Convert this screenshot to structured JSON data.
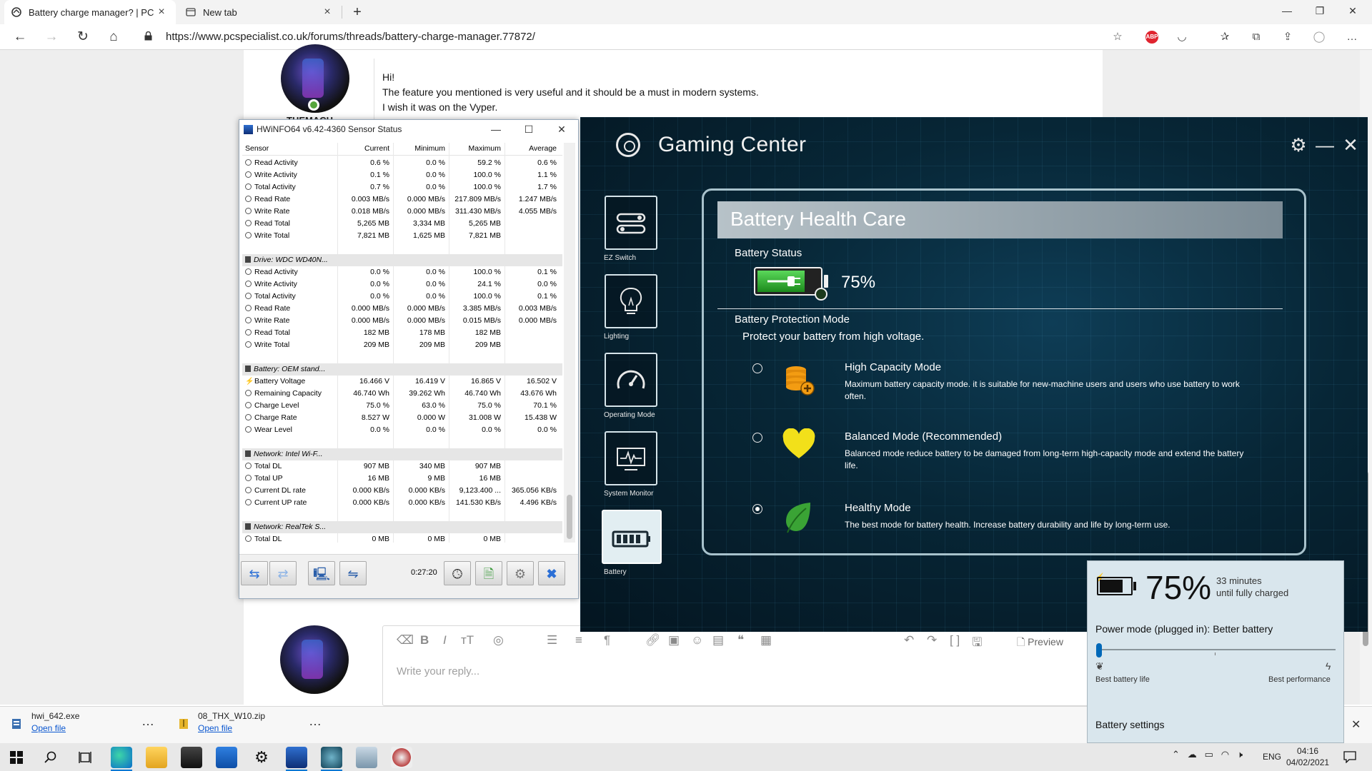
{
  "browser": {
    "tabs": [
      {
        "title": "Battery charge manager? | PCSPE"
      },
      {
        "title": "New tab"
      }
    ],
    "new_tab_symbol": "+",
    "url": "https://www.pcspecialist.co.uk/forums/threads/battery-charge-manager.77872/",
    "extension_abp": "ABP"
  },
  "post": {
    "username_partial": "THEMACH",
    "lines": [
      "Hi!",
      "The feature you mentioned is very useful and it should be a must in modern systems.",
      "I wish it was on the Vyper."
    ],
    "reply_placeholder": "Write your reply...",
    "preview_label": "Preview"
  },
  "hwinfo": {
    "title": "HWiNFO64 v6.42-4360 Sensor Status",
    "columns": [
      "Sensor",
      "Current",
      "Minimum",
      "Maximum",
      "Average"
    ],
    "rows": [
      {
        "type": "sensor",
        "icon": "circle",
        "cells": [
          "Read Activity",
          "0.6 %",
          "0.0 %",
          "59.2 %",
          "0.6 %"
        ]
      },
      {
        "type": "sensor",
        "icon": "circle",
        "cells": [
          "Write Activity",
          "0.1 %",
          "0.0 %",
          "100.0 %",
          "1.1 %"
        ]
      },
      {
        "type": "sensor",
        "icon": "circle",
        "cells": [
          "Total Activity",
          "0.7 %",
          "0.0 %",
          "100.0 %",
          "1.7 %"
        ]
      },
      {
        "type": "sensor",
        "icon": "circle",
        "cells": [
          "Read Rate",
          "0.003 MB/s",
          "0.000 MB/s",
          "217.809 MB/s",
          "1.247 MB/s"
        ]
      },
      {
        "type": "sensor",
        "icon": "circle",
        "cells": [
          "Write Rate",
          "0.018 MB/s",
          "0.000 MB/s",
          "311.430 MB/s",
          "4.055 MB/s"
        ]
      },
      {
        "type": "sensor",
        "icon": "circle",
        "cells": [
          "Read Total",
          "5,265 MB",
          "3,334 MB",
          "5,265 MB",
          ""
        ]
      },
      {
        "type": "sensor",
        "icon": "circle",
        "cells": [
          "Write Total",
          "7,821 MB",
          "1,625 MB",
          "7,821 MB",
          ""
        ]
      },
      {
        "type": "blank",
        "cells": [
          "",
          "",
          "",
          "",
          ""
        ]
      },
      {
        "type": "group",
        "icon": "drive",
        "cells": [
          "Drive: WDC WD40N...",
          "",
          "",
          "",
          ""
        ]
      },
      {
        "type": "sensor",
        "icon": "circle",
        "cells": [
          "Read Activity",
          "0.0 %",
          "0.0 %",
          "100.0 %",
          "0.1 %"
        ]
      },
      {
        "type": "sensor",
        "icon": "circle",
        "cells": [
          "Write Activity",
          "0.0 %",
          "0.0 %",
          "24.1 %",
          "0.0 %"
        ]
      },
      {
        "type": "sensor",
        "icon": "circle",
        "cells": [
          "Total Activity",
          "0.0 %",
          "0.0 %",
          "100.0 %",
          "0.1 %"
        ]
      },
      {
        "type": "sensor",
        "icon": "circle",
        "cells": [
          "Read Rate",
          "0.000 MB/s",
          "0.000 MB/s",
          "3.385 MB/s",
          "0.003 MB/s"
        ]
      },
      {
        "type": "sensor",
        "icon": "circle",
        "cells": [
          "Write Rate",
          "0.000 MB/s",
          "0.000 MB/s",
          "0.015 MB/s",
          "0.000 MB/s"
        ]
      },
      {
        "type": "sensor",
        "icon": "circle",
        "cells": [
          "Read Total",
          "182 MB",
          "178 MB",
          "182 MB",
          ""
        ]
      },
      {
        "type": "sensor",
        "icon": "circle",
        "cells": [
          "Write Total",
          "209 MB",
          "209 MB",
          "209 MB",
          ""
        ]
      },
      {
        "type": "blank",
        "cells": [
          "",
          "",
          "",
          "",
          ""
        ]
      },
      {
        "type": "group",
        "icon": "drive",
        "cells": [
          "Battery: OEM stand...",
          "",
          "",
          "",
          ""
        ]
      },
      {
        "type": "sensor",
        "icon": "bolt",
        "cells": [
          "Battery Voltage",
          "16.466 V",
          "16.419 V",
          "16.865 V",
          "16.502 V"
        ]
      },
      {
        "type": "sensor",
        "icon": "circle",
        "cells": [
          "Remaining Capacity",
          "46.740 Wh",
          "39.262 Wh",
          "46.740 Wh",
          "43.676 Wh"
        ]
      },
      {
        "type": "sensor",
        "icon": "circle",
        "cells": [
          "Charge Level",
          "75.0 %",
          "63.0 %",
          "75.0 %",
          "70.1 %"
        ]
      },
      {
        "type": "sensor",
        "icon": "circle",
        "cells": [
          "Charge Rate",
          "8.527 W",
          "0.000 W",
          "31.008 W",
          "15.438 W"
        ]
      },
      {
        "type": "sensor",
        "icon": "circle",
        "cells": [
          "Wear Level",
          "0.0 %",
          "0.0 %",
          "0.0 %",
          "0.0 %"
        ]
      },
      {
        "type": "blank",
        "cells": [
          "",
          "",
          "",
          "",
          ""
        ]
      },
      {
        "type": "group",
        "icon": "drive",
        "cells": [
          "Network: Intel Wi-F...",
          "",
          "",
          "",
          ""
        ]
      },
      {
        "type": "sensor",
        "icon": "circle",
        "cells": [
          "Total DL",
          "907 MB",
          "340 MB",
          "907 MB",
          ""
        ]
      },
      {
        "type": "sensor",
        "icon": "circle",
        "cells": [
          "Total UP",
          "16 MB",
          "9 MB",
          "16 MB",
          ""
        ]
      },
      {
        "type": "sensor",
        "icon": "circle",
        "cells": [
          "Current DL rate",
          "0.000 KB/s",
          "0.000 KB/s",
          "9,123.400 ...",
          "365.056 KB/s"
        ]
      },
      {
        "type": "sensor",
        "icon": "circle",
        "cells": [
          "Current UP rate",
          "0.000 KB/s",
          "0.000 KB/s",
          "141.530 KB/s",
          "4.496 KB/s"
        ]
      },
      {
        "type": "blank",
        "cells": [
          "",
          "",
          "",
          "",
          ""
        ]
      },
      {
        "type": "group",
        "icon": "drive",
        "cells": [
          "Network: RealTek S...",
          "",
          "",
          "",
          ""
        ]
      },
      {
        "type": "sensor",
        "icon": "circle",
        "cells": [
          "Total DL",
          "0 MB",
          "0 MB",
          "0 MB",
          ""
        ]
      },
      {
        "type": "sensor",
        "icon": "circle",
        "cells": [
          "Total UP",
          "0 MB",
          "0 MB",
          "0 MB",
          ""
        ]
      }
    ],
    "timer": "0:27:20"
  },
  "gaming_center": {
    "title": "Gaming Center",
    "nav": [
      {
        "label": "EZ Switch",
        "icon": "ez-switch-icon"
      },
      {
        "label": "Lighting",
        "icon": "lightbulb-icon"
      },
      {
        "label": "Operating Mode",
        "icon": "speedometer-icon"
      },
      {
        "label": "System Monitor",
        "icon": "monitor-icon"
      },
      {
        "label": "Battery",
        "icon": "battery-icon"
      }
    ],
    "section_title": "Battery Health Care",
    "battery_status_label": "Battery Status",
    "battery_percent": "75%",
    "battery_level": 0.75,
    "protection_label": "Battery Protection Mode",
    "protection_desc": "Protect your battery from high voltage.",
    "modes": [
      {
        "name": "High Capacity Mode",
        "desc": "Maximum battery capacity mode. it is suitable for new-machine users and users who use battery to work often.",
        "selected": false,
        "icon": "battery-stack-icon"
      },
      {
        "name": "Balanced Mode (Recommended)",
        "desc": "Balanced mode reduce battery to be damaged from long-term high-capacity mode and  extend the battery life.",
        "selected": false,
        "icon": "heart-icon"
      },
      {
        "name": "Healthy Mode",
        "desc": "The best mode for battery health. Increase battery durability and life by long-term use.",
        "selected": true,
        "icon": "leaf-icon"
      }
    ]
  },
  "battery_flyout": {
    "percent": "75%",
    "time_line1": "33 minutes",
    "time_line2": "until fully charged",
    "power_mode": "Power mode (plugged in): Better battery",
    "slider_position": 0,
    "left_label": "Best battery life",
    "right_label": "Best performance",
    "settings_link": "Battery settings"
  },
  "downloads": [
    {
      "filename": "hwi_642.exe",
      "action": "Open file"
    },
    {
      "filename": "08_THX_W10.zip",
      "action": "Open file"
    }
  ],
  "taskbar": {
    "language": "ENG",
    "time": "04:16",
    "date": "04/02/2021"
  },
  "colors": {
    "accent": "#0078d4",
    "gc_background": "#072636",
    "battery_green": "#2fb82f",
    "heart_yellow": "#f2e01a",
    "capacity_orange": "#f39c12",
    "leaf_green": "#3aa335"
  }
}
